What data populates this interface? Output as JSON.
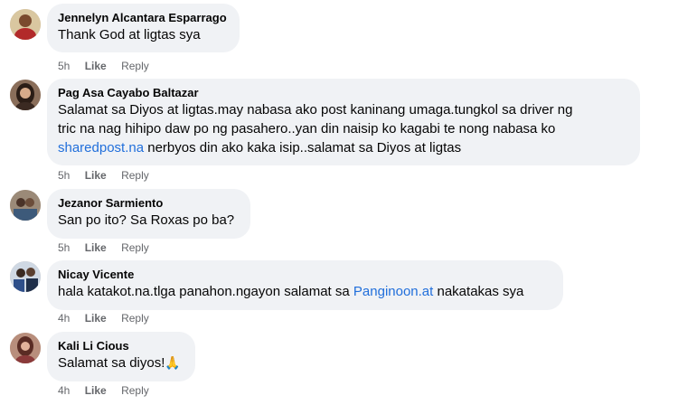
{
  "comments": [
    {
      "author": "Jennelyn Alcantara Esparrago",
      "text": "Thank God at ligtas sya",
      "time": "5h",
      "like": "Like",
      "reply": "Reply"
    },
    {
      "author": "Pag Asa Cayabo Baltazar",
      "text_line1": "Salamat sa Diyos at ligtas.may nabasa ako post kaninang umaga.tungkol sa driver ng",
      "text_line2": "tric na nag hihipo daw po ng pasahero..yan din naisip ko kagabi te nong nabasa ko",
      "text_link": "sharedpost.na",
      "text_line3_rest": " nerbyos din ako kaka isip..salamat sa Diyos at ligtas",
      "time": "5h",
      "like": "Like",
      "reply": "Reply"
    },
    {
      "author": "Jezanor Sarmiento",
      "text": "San po ito? Sa Roxas po ba?",
      "time": "5h",
      "like": "Like",
      "reply": "Reply"
    },
    {
      "author": "Nicay Vicente",
      "text_before": "hala katakot.na.tlga panahon.ngayon salamat sa ",
      "text_link": "Panginoon.at",
      "text_after": " nakatakas sya",
      "time": "4h",
      "like": "Like",
      "reply": "Reply"
    },
    {
      "author": "Kali Li Cious",
      "text": "Salamat sa diyos!",
      "emoji": "🙏",
      "time": "4h",
      "like": "Like",
      "reply": "Reply"
    }
  ],
  "colors": {
    "bubble": "#f0f2f5",
    "text": "#050505",
    "meta": "#65676b",
    "link": "#216fdb"
  },
  "icons": [
    "avatar-photo",
    "folded-hands-emoji"
  ]
}
